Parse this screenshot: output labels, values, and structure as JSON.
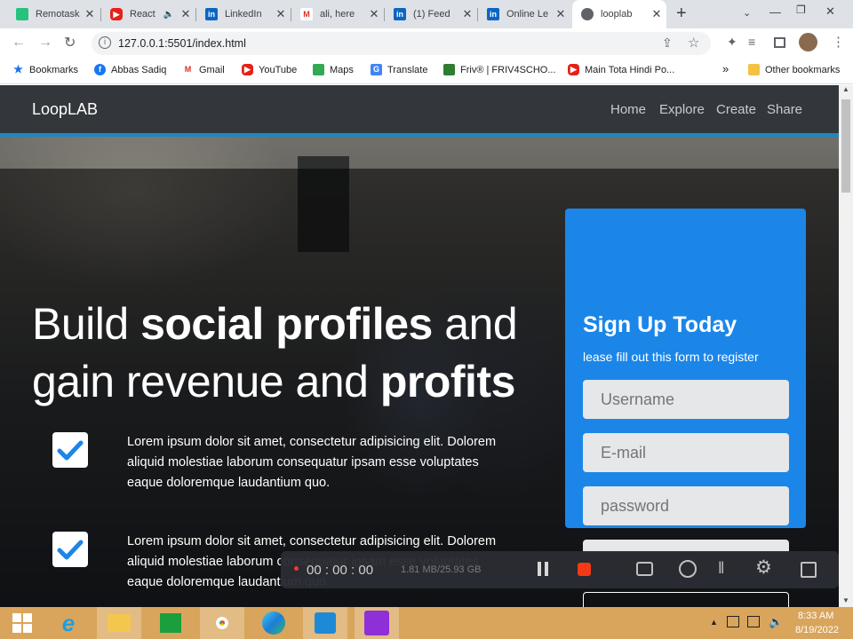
{
  "tabs": [
    {
      "title": "Remotasks",
      "close": "✕"
    },
    {
      "title": "React",
      "close": "✕"
    },
    {
      "title": "LinkedIn",
      "close": "✕"
    },
    {
      "title": "ali, here",
      "close": "✕"
    },
    {
      "title": "(1) Feed",
      "close": "✕"
    },
    {
      "title": "Online Le",
      "close": "✕"
    },
    {
      "title": "looplab",
      "close": "✕"
    }
  ],
  "new_tab": "+",
  "url": "127.0.0.1:5501/index.html",
  "bookmarks": [
    "Bookmarks",
    "Abbas Sadiq",
    "Gmail",
    "YouTube",
    "Maps",
    "Translate",
    "Friv® | FRIV4SCHO...",
    "Main Tota Hindi Po..."
  ],
  "bookmarks_more": "»",
  "other_bookmarks": "Other bookmarks",
  "site": {
    "brand": "LoopLAB",
    "nav": [
      "Home",
      "Explore",
      "Create",
      "Share"
    ],
    "headline": {
      "l1a": "Build ",
      "l1b": "social profiles",
      "l1c": " and",
      "l2a": "gain revenue and ",
      "l2b": "profits"
    },
    "features": [
      "Lorem ipsum dolor sit amet, consectetur adipisicing elit. Dolorem aliquid molestiae laborum consequatur ipsam esse voluptates eaque doloremque laudantium quo.",
      "Lorem ipsum dolor sit amet, consectetur adipisicing elit. Dolorem aliquid molestiae laborum consequatur ipsam esse voluptates eaque doloremque laudantium quo."
    ],
    "form": {
      "title": "Sign Up Today",
      "subtitle": "lease fill out this form to register",
      "username_placeholder": "Username",
      "email_placeholder": "E-mail",
      "password_placeholder": "password"
    }
  },
  "recorder": {
    "time": "00 : 00 : 00",
    "size": "1.81 MB/25.93 GB"
  },
  "clock": {
    "time": "8:33 AM",
    "date": "8/19/2022"
  },
  "colors": {
    "accent": "#1b86e8",
    "navbar": "#33373b",
    "navline": "#1a87c9",
    "taskbar": "#d9a55c"
  }
}
